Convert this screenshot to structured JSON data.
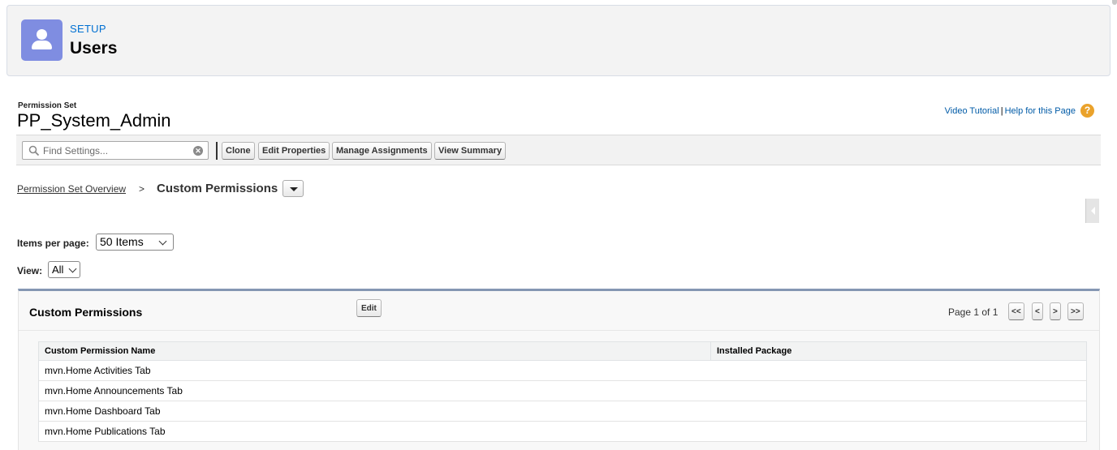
{
  "setup": {
    "section_label": "SETUP",
    "title": "Users"
  },
  "permission_set": {
    "label": "Permission Set",
    "name": "PP_System_Admin"
  },
  "help": {
    "video_tutorial": "Video Tutorial",
    "separator": "|",
    "help_page": "Help for this Page",
    "icon": "question-icon"
  },
  "toolbar": {
    "search_placeholder": "Find Settings...",
    "clone_label": "Clone",
    "edit_properties_label": "Edit Properties",
    "manage_assignments_label": "Manage Assignments",
    "view_summary_label": "View Summary"
  },
  "breadcrumb": {
    "parent": "Permission Set Overview",
    "separator": ">",
    "current": "Custom Permissions"
  },
  "filters": {
    "items_per_page_label": "Items per page:",
    "items_per_page_value": "50 Items",
    "view_label": "View:",
    "view_value": "All"
  },
  "panel": {
    "title": "Custom Permissions",
    "edit_label": "Edit",
    "page_info": "Page 1 of 1",
    "pager": {
      "first": "<<",
      "prev": "<",
      "next": ">",
      "last": ">>"
    }
  },
  "table": {
    "columns": [
      "Custom Permission Name",
      "Installed Package"
    ],
    "rows": [
      [
        "mvn.Home Activities Tab",
        ""
      ],
      [
        "mvn.Home Announcements Tab",
        ""
      ],
      [
        "mvn.Home Dashboard Tab",
        ""
      ],
      [
        "mvn.Home Publications Tab",
        ""
      ]
    ]
  },
  "colors": {
    "accent_link": "#015ba7",
    "setup_link": "#0070d2",
    "avatar_bg": "#7f8de1",
    "panel_border": "#8597b3",
    "help_icon": "#eaa22b"
  }
}
